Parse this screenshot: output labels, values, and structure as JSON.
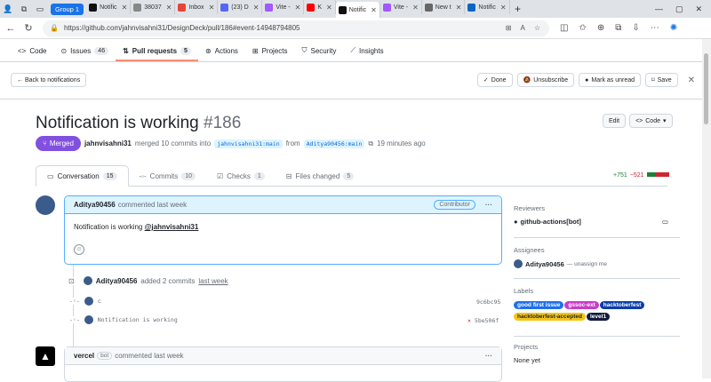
{
  "browser": {
    "group_label": "Group 1",
    "tabs": [
      {
        "label": "Notific",
        "icon": "github-icon"
      },
      {
        "label": "38037",
        "icon": "doc-icon"
      },
      {
        "label": "Inbox",
        "icon": "gmail-icon"
      },
      {
        "label": "(23) D",
        "icon": "discord-icon"
      },
      {
        "label": "Vite -",
        "icon": "vite-icon"
      },
      {
        "label": "K",
        "icon": "youtube-icon"
      },
      {
        "label": "Notific",
        "icon": "github-icon"
      },
      {
        "label": "Vite -",
        "icon": "vite-icon"
      },
      {
        "label": "New t",
        "icon": "newtab-icon"
      },
      {
        "label": "Notific",
        "icon": "linkedin-icon"
      }
    ],
    "url": "https://github.com/jahnvisahni31/DesignDeck/pull/186#event-14948794805"
  },
  "repo_nav": [
    {
      "label": "Code",
      "count": ""
    },
    {
      "label": "Issues",
      "count": "46"
    },
    {
      "label": "Pull requests",
      "count": "5"
    },
    {
      "label": "Actions",
      "count": ""
    },
    {
      "label": "Projects",
      "count": ""
    },
    {
      "label": "Security",
      "count": ""
    },
    {
      "label": "Insights",
      "count": ""
    }
  ],
  "notif_bar": {
    "back": "← Back to notifications",
    "done": "Done",
    "unsubscribe": "Unsubscribe",
    "mark_unread": "Mark as unread",
    "save": "Save"
  },
  "pr": {
    "title": "Notification is working",
    "number": "#186",
    "edit": "Edit",
    "code": "Code",
    "status": "Merged",
    "author": "jahnvisahni31",
    "merged_text": "merged 10 commits into",
    "base": "jahnvisahni31:main",
    "from": "from",
    "head": "Aditya90456:main",
    "time": "19 minutes ago"
  },
  "pr_tabs": [
    {
      "label": "Conversation",
      "count": "15"
    },
    {
      "label": "Commits",
      "count": "10"
    },
    {
      "label": "Checks",
      "count": "1"
    },
    {
      "label": "Files changed",
      "count": "5"
    }
  ],
  "diff": {
    "added": "+751",
    "removed": "−521"
  },
  "comment": {
    "author": "Aditya90456",
    "meta": "commented last week",
    "badge": "Contributor",
    "body": "Notification is working",
    "mention": "@jahnvisahni31"
  },
  "push_event": {
    "author": "Aditya90456",
    "text": "added 2 commits",
    "time": "last week"
  },
  "commits": [
    {
      "msg": "c",
      "sha": "9c6bc95"
    },
    {
      "msg": "Notification is working",
      "sha": "5be506f"
    }
  ],
  "vercel": {
    "author": "vercel",
    "badge": "bot",
    "meta": "commented last week"
  },
  "sidebar": {
    "reviewers_h": "Reviewers",
    "reviewer": "github-actions[bot]",
    "assignees_h": "Assignees",
    "assignee": "Aditya90456",
    "assignee_note": "— unassign me",
    "labels_h": "Labels",
    "labels": [
      {
        "text": "good first issue",
        "bg": "#1f6feb",
        "fg": "#ffffff"
      },
      {
        "text": "gssoc-ext",
        "bg": "#c93cc9",
        "fg": "#ffffff"
      },
      {
        "text": "hacktoberfest",
        "bg": "#0b3ea8",
        "fg": "#ffffff"
      },
      {
        "text": "hacktoberfest-accepted",
        "bg": "#f5c518",
        "fg": "#1f2328"
      },
      {
        "text": "level1",
        "bg": "#121a3d",
        "fg": "#ffffff"
      }
    ],
    "projects_h": "Projects",
    "projects": "None yet"
  }
}
